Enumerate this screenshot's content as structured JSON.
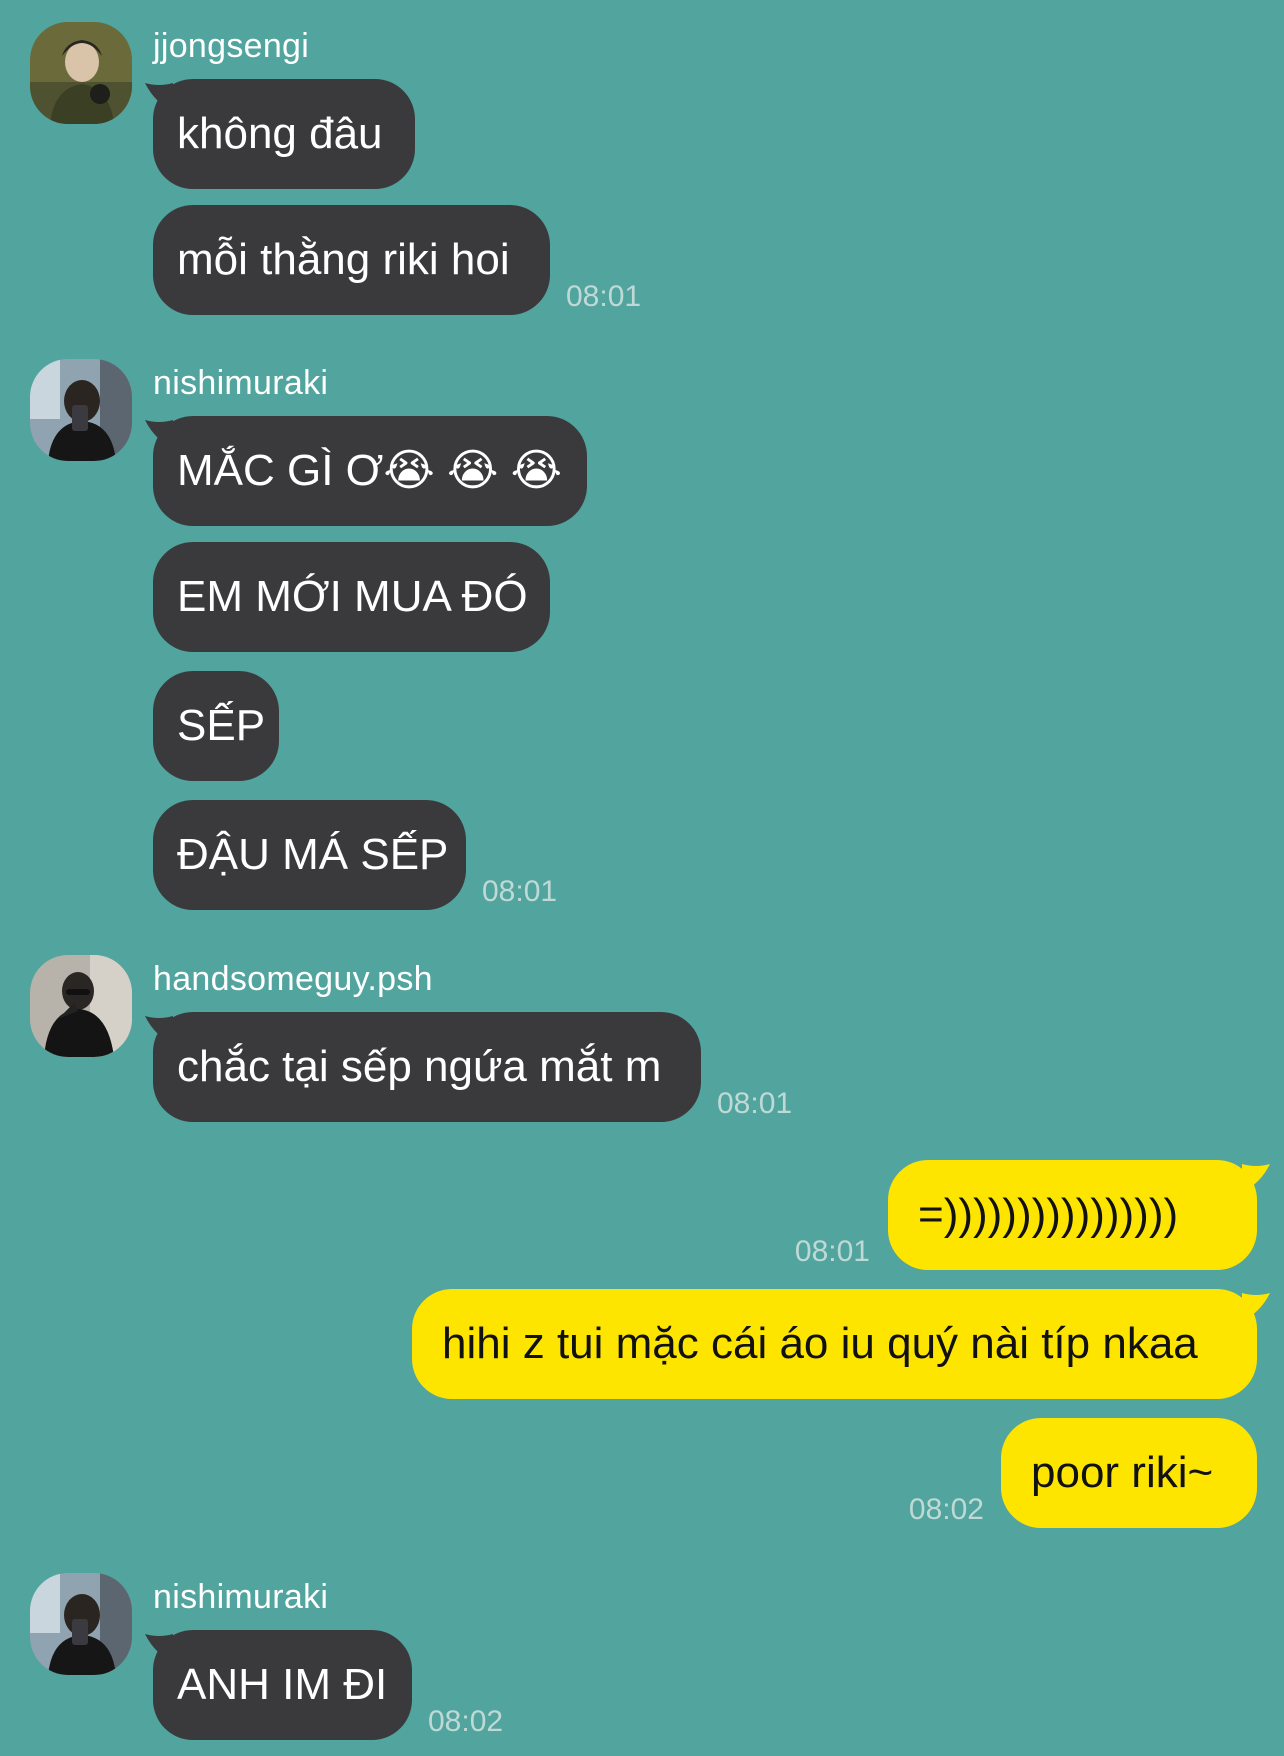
{
  "colors": {
    "background": "#52A49E",
    "incoming_bubble": "#3A3A3C",
    "outgoing_bubble": "#FEE500",
    "timestamp": "#BFD9D6"
  },
  "messages": {
    "g1": {
      "sender": "jjongsengi",
      "avatar": "jjongsengi-avatar",
      "m1": "không đâu",
      "m2": "mỗi thằng riki hoi",
      "time": "08:01"
    },
    "g2": {
      "sender": "nishimuraki",
      "avatar": "nishimuraki-avatar",
      "m1": "MẮC GÌ Ơ😭 😭 😭",
      "m2": "EM MỚI MUA ĐÓ",
      "m3": "SẾP",
      "m4": "ĐẬU MÁ SẾP",
      "time": "08:01"
    },
    "g3": {
      "sender": "handsomeguy.psh",
      "avatar": "handsomeguy-avatar",
      "m1": "chắc tại sếp ngứa mắt m",
      "time": "08:01"
    },
    "me1": {
      "m1": "=))))))))))))))))",
      "time": "08:01"
    },
    "me2": {
      "m1": "hihi z tui mặc cái áo iu quý nài típ nkaa",
      "m2": "poor riki~",
      "time": "08:02"
    },
    "g4": {
      "sender": "nishimuraki",
      "avatar": "nishimuraki-avatar",
      "m1": "ANH IM ĐI",
      "time": "08:02"
    }
  }
}
